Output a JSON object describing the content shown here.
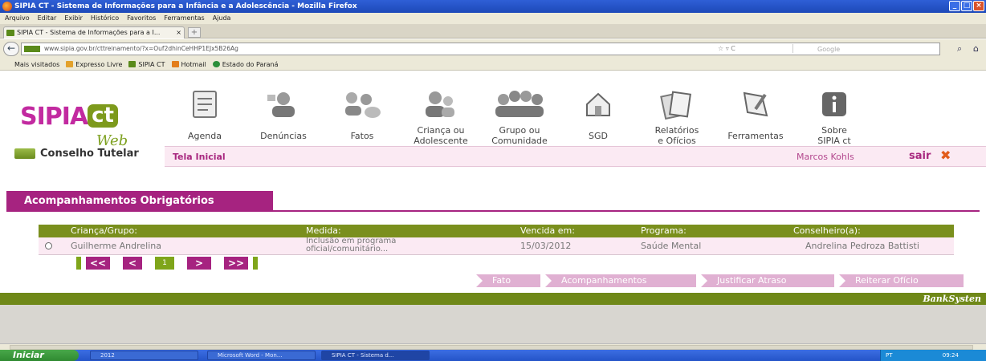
{
  "window": {
    "title": "SIPIA CT - Sistema de Informações para a Infância e a Adolescência - Mozilla Firefox"
  },
  "menubar": [
    "Arquivo",
    "Editar",
    "Exibir",
    "Histórico",
    "Favoritos",
    "Ferramentas",
    "Ajuda"
  ],
  "tab": {
    "label": "SIPIA CT - Sistema de Informações para a I..."
  },
  "navbar": {
    "url": "www.sipia.gov.br/cttreinamento/?x=Ouf2dhinCeHHP1EJx5B26Ag",
    "search_placeholder": "Google"
  },
  "bookmarks": [
    "Mais visitados",
    "Expresso Livre",
    "SIPIA CT",
    "Hotmail",
    "Estado do Paraná"
  ],
  "logo": {
    "sipia": "SIPIA",
    "ct": "ct",
    "web": "Web"
  },
  "sidebar": {
    "module": "Conselho Tutelar"
  },
  "menu": [
    {
      "line1": "Agenda",
      "line2": "",
      "icon": "agenda-icon"
    },
    {
      "line1": "Denúncias",
      "line2": "",
      "icon": "denuncias-icon"
    },
    {
      "line1": "Fatos",
      "line2": "",
      "icon": "fatos-icon"
    },
    {
      "line1": "Criança ou",
      "line2": "Adolescente",
      "icon": "crianca-icon"
    },
    {
      "line1": "Grupo ou",
      "line2": "Comunidade",
      "icon": "grupo-icon"
    },
    {
      "line1": "SGD",
      "line2": "",
      "icon": "sgd-icon"
    },
    {
      "line1": "Relatórios",
      "line2": "e Ofícios",
      "icon": "relatorios-icon"
    },
    {
      "line1": "Ferramentas",
      "line2": "",
      "icon": "ferramentas-icon"
    },
    {
      "line1": "Sobre",
      "line2": "SIPIA ct",
      "icon": "info-icon"
    }
  ],
  "subbar": {
    "home": "Tela Inicial",
    "user": "Marcos Kohls",
    "logout": "sair"
  },
  "section": {
    "title": "Acompanhamentos Obrigatórios"
  },
  "table": {
    "headers": [
      "Criança/Grupo:",
      "Medida:",
      "Vencida em:",
      "Programa:",
      "Conselheiro(a):"
    ],
    "rows": [
      {
        "crianca": "Guilherme Andrelina",
        "medida1": "Inclusão em programa",
        "medida2": "oficial/comunitário...",
        "vencida": "15/03/2012",
        "programa": "Saúde Mental",
        "conselheiro": "Andrelina Pedroza Battisti"
      }
    ]
  },
  "pager": {
    "first": "<<",
    "prev": "<",
    "current": "1",
    "next": ">",
    "last": ">>"
  },
  "actions": [
    "Fato",
    "Acompanhamentos",
    "Justificar Atraso",
    "Reiterar Ofício"
  ],
  "footer": {
    "brand": "BankSysten"
  },
  "taskbar": {
    "start": "Iniciar",
    "tasks": [
      "2012",
      "Microsoft Word - Mon...",
      "SIPIA CT - Sistema d..."
    ],
    "tray": "PT",
    "clock": "09:24"
  },
  "colors": {
    "brand_magenta": "#a62380",
    "brand_green": "#7a8f1d",
    "row_bg": "#fbeaf3"
  }
}
